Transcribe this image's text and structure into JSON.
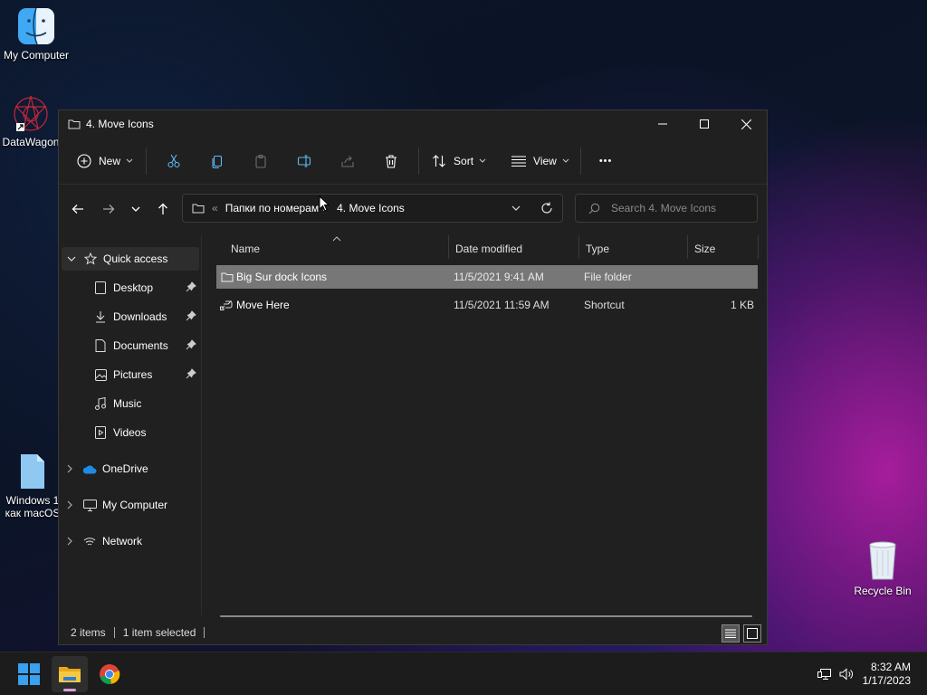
{
  "desktop": {
    "icons": [
      {
        "label": "My Computer"
      },
      {
        "label": "DataWagon"
      },
      {
        "label": "Windows 1\nкак macOS"
      },
      {
        "label": "Recycle Bin"
      }
    ]
  },
  "window": {
    "title": "4. Move Icons",
    "controls": {
      "minimize": "—",
      "maximize": "☐",
      "close": "✕"
    }
  },
  "toolbar": {
    "new_label": "New",
    "sort_label": "Sort",
    "view_label": "View",
    "more_label": "•••"
  },
  "address": {
    "segments": [
      "Папки по номерам",
      "4. Move Icons"
    ],
    "overflow": "«",
    "separator": "›"
  },
  "search": {
    "placeholder": "Search 4. Move Icons"
  },
  "sidebar": {
    "items": [
      {
        "label": "Quick access"
      },
      {
        "label": "Desktop"
      },
      {
        "label": "Downloads"
      },
      {
        "label": "Documents"
      },
      {
        "label": "Pictures"
      },
      {
        "label": "Music"
      },
      {
        "label": "Videos"
      },
      {
        "label": "OneDrive"
      },
      {
        "label": "My Computer"
      },
      {
        "label": "Network"
      }
    ]
  },
  "columns": {
    "name": "Name",
    "date": "Date modified",
    "type": "Type",
    "size": "Size"
  },
  "files": [
    {
      "name": "Big Sur dock Icons",
      "date": "11/5/2021 9:41 AM",
      "type": "File folder",
      "size": "",
      "selected": true
    },
    {
      "name": "Move Here",
      "date": "11/5/2021 11:59 AM",
      "type": "Shortcut",
      "size": "1 KB",
      "selected": false
    }
  ],
  "status": {
    "count": "2 items",
    "selection": "1 item selected"
  },
  "taskbar": {
    "time": "8:32 AM",
    "date": "1/17/2023"
  },
  "colors": {
    "accent": "#4cc2ff",
    "selection": "#777777",
    "folder": "#f4c542"
  }
}
